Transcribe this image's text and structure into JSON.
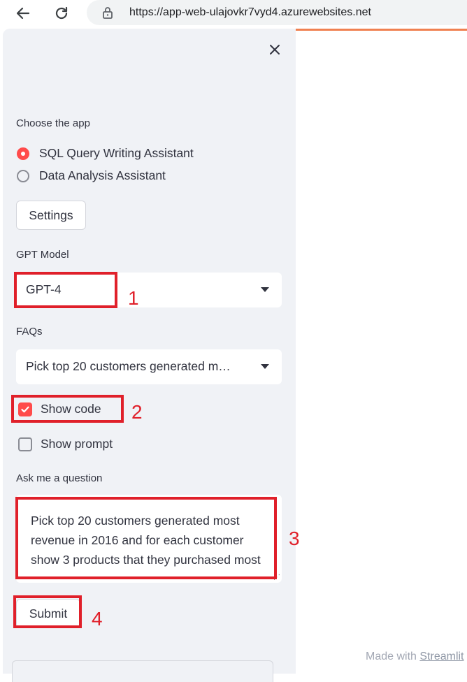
{
  "browser": {
    "url": "https://app-web-ulajovkr7vyd4.azurewebsites.net"
  },
  "sidebar": {
    "choose_app_label": "Choose the app",
    "app_options": [
      {
        "label": "SQL Query Writing Assistant",
        "selected": true
      },
      {
        "label": "Data Analysis Assistant",
        "selected": false
      }
    ],
    "settings_label": "Settings",
    "gpt_model_label": "GPT Model",
    "gpt_model_value": "GPT-4",
    "faqs_label": "FAQs",
    "faqs_value": "Pick top 20 customers generated m…",
    "show_code_label": "Show code",
    "show_code_checked": true,
    "show_prompt_label": "Show prompt",
    "show_prompt_checked": false,
    "question_label": "Ask me a question",
    "question_value": "Pick top 20 customers generated most revenue in 2016 and for each customer show 3 products that they purchased most",
    "submit_label": "Submit"
  },
  "annotations": [
    "1",
    "2",
    "3",
    "4"
  ],
  "footer": {
    "made_with": "Made with",
    "brand": "Streamlit"
  },
  "colors": {
    "accent": "#ff4b4b",
    "annotation": "#e0202a",
    "sidebar_bg": "#f0f2f6"
  }
}
